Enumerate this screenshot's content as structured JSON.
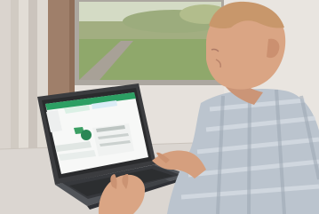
{
  "scene": {
    "subject": "man-using-laptop",
    "accent_color": "#1f9a5a",
    "screen_color": "#f7f8f7",
    "shirt_color": "#b7c1cb",
    "skin_color": "#d8a07d",
    "lawn_color": "#7f9c55",
    "desk_color": "#d9d4cf"
  }
}
